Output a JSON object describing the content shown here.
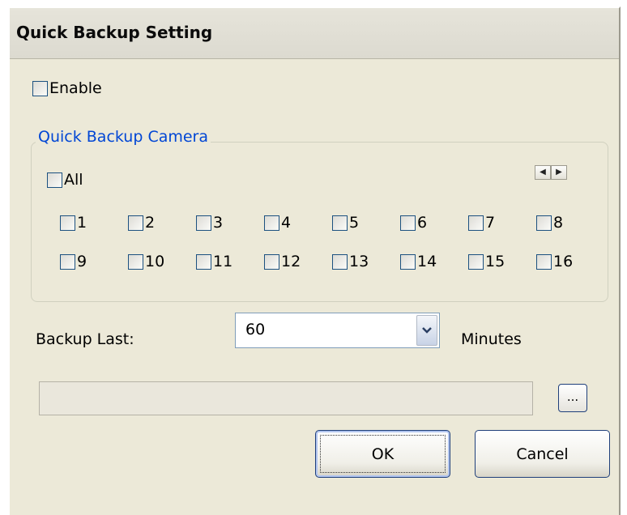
{
  "window": {
    "title": "Quick Backup Setting"
  },
  "enable": {
    "label": "Enable",
    "checked": false
  },
  "camera_group": {
    "title": "Quick Backup Camera",
    "all_label": "All",
    "all_checked": false,
    "cameras": [
      "1",
      "2",
      "3",
      "4",
      "5",
      "6",
      "7",
      "8",
      "9",
      "10",
      "11",
      "12",
      "13",
      "14",
      "15",
      "16"
    ]
  },
  "backup_last": {
    "label": "Backup Last:",
    "value": "60",
    "unit": "Minutes"
  },
  "path": {
    "value": ""
  },
  "browse": {
    "label": "..."
  },
  "buttons": {
    "ok": "OK",
    "cancel": "Cancel"
  },
  "icons": {
    "spin_left": "left-arrow-icon",
    "spin_right": "right-arrow-icon",
    "dropdown": "chevron-down-icon"
  }
}
